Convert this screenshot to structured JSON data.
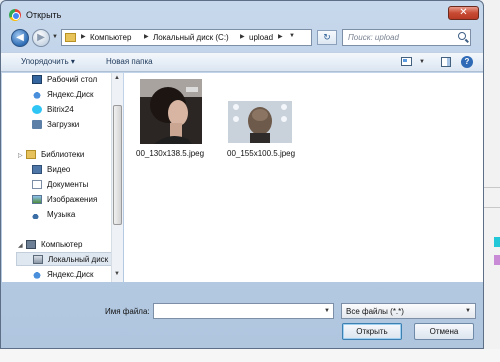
{
  "window": {
    "title": "Открыть",
    "close_label": "✕"
  },
  "nav": {
    "back_label": "◀",
    "forward_label": "▶"
  },
  "address": {
    "crumbs": [
      "Компьютер",
      "Локальный диск (C:)",
      "upload"
    ],
    "refresh_label": "↻"
  },
  "search": {
    "placeholder": "Поиск: upload"
  },
  "toolbar": {
    "organize_label": "Упорядочить ▾",
    "new_folder_label": "Новая папка",
    "help_label": "?"
  },
  "sidebar": {
    "items": [
      {
        "label": "Рабочий стол"
      },
      {
        "label": "Яндекс.Диск"
      },
      {
        "label": "Bitrix24"
      },
      {
        "label": "Загрузки"
      },
      {
        "label": "Библиотеки"
      },
      {
        "label": "Видео"
      },
      {
        "label": "Документы"
      },
      {
        "label": "Изображения"
      },
      {
        "label": "Музыка"
      },
      {
        "label": "Компьютер"
      },
      {
        "label": "Локальный диск"
      },
      {
        "label": "Яндекс.Диск"
      }
    ]
  },
  "files": [
    {
      "name": "00_130x138.5.jpeg"
    },
    {
      "name": "00_155x100.5.jpeg"
    }
  ],
  "bottom": {
    "file_name_label": "Имя файла:",
    "file_name_value": "",
    "file_type_value": "Все файлы (*.*)",
    "open_label": "Открыть",
    "cancel_label": "Отмена"
  }
}
